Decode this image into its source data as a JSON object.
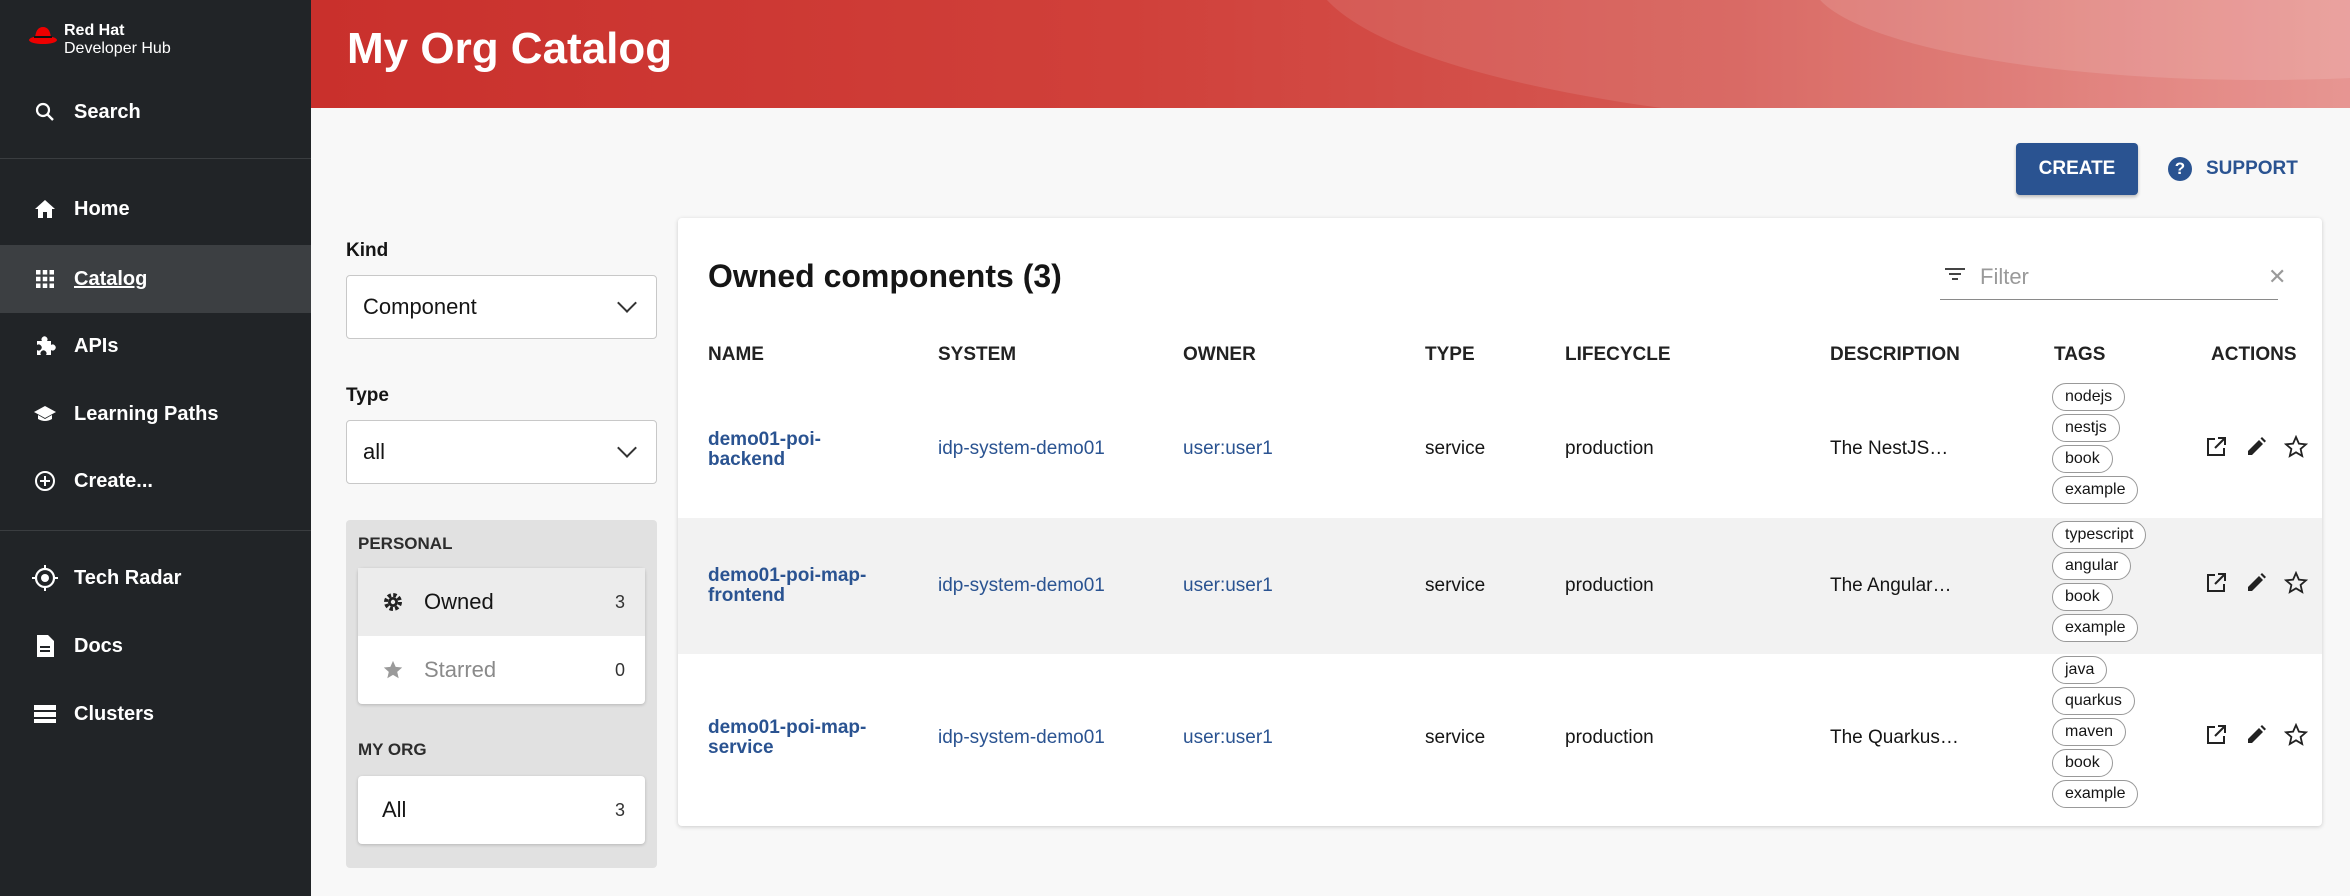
{
  "sidebar": {
    "logo_line1": "Red Hat",
    "logo_line2": "Developer Hub",
    "search_label": "Search",
    "items": [
      {
        "label": "Home",
        "icon": "home-icon"
      },
      {
        "label": "Catalog",
        "icon": "grid-icon",
        "active": true
      },
      {
        "label": "APIs",
        "icon": "puzzle-icon"
      },
      {
        "label": "Learning Paths",
        "icon": "school-icon"
      },
      {
        "label": "Create...",
        "icon": "plus-circle-icon"
      },
      {
        "label": "Tech Radar",
        "icon": "radar-icon"
      },
      {
        "label": "Docs",
        "icon": "document-icon"
      },
      {
        "label": "Clusters",
        "icon": "storage-icon"
      }
    ]
  },
  "header": {
    "title": "My Org Catalog"
  },
  "actions": {
    "create_label": "CREATE",
    "support_label": "SUPPORT"
  },
  "filters": {
    "kind_label": "Kind",
    "kind_value": "Component",
    "type_label": "Type",
    "type_value": "all",
    "personal_heading": "PERSONAL",
    "owned_label": "Owned",
    "owned_count": "3",
    "starred_label": "Starred",
    "starred_count": "0",
    "org_heading": "MY ORG",
    "all_label": "All",
    "all_count": "3"
  },
  "table": {
    "title": "Owned components (3)",
    "filter_placeholder": "Filter",
    "columns": [
      "NAME",
      "SYSTEM",
      "OWNER",
      "TYPE",
      "LIFECYCLE",
      "DESCRIPTION",
      "TAGS",
      "ACTIONS"
    ],
    "rows": [
      {
        "name_l1": "demo01-poi-",
        "name_l2": "backend",
        "system": "idp-system-demo01",
        "owner": "user:user1",
        "type": "service",
        "lifecycle": "production",
        "description": "The NestJS…",
        "tags": [
          "nodejs",
          "nestjs",
          "book",
          "example"
        ]
      },
      {
        "name_l1": "demo01-poi-map-",
        "name_l2": "frontend",
        "system": "idp-system-demo01",
        "owner": "user:user1",
        "type": "service",
        "lifecycle": "production",
        "description": "The Angular…",
        "tags": [
          "typescript",
          "angular",
          "book",
          "example"
        ]
      },
      {
        "name_l1": "demo01-poi-map-",
        "name_l2": "service",
        "system": "idp-system-demo01",
        "owner": "user:user1",
        "type": "service",
        "lifecycle": "production",
        "description": "The Quarkus…",
        "tags": [
          "java",
          "quarkus",
          "maven",
          "book",
          "example"
        ]
      }
    ]
  },
  "colors": {
    "brand_red": "#cc0000",
    "link_blue": "#2a5391",
    "sidebar_bg": "#212427"
  }
}
